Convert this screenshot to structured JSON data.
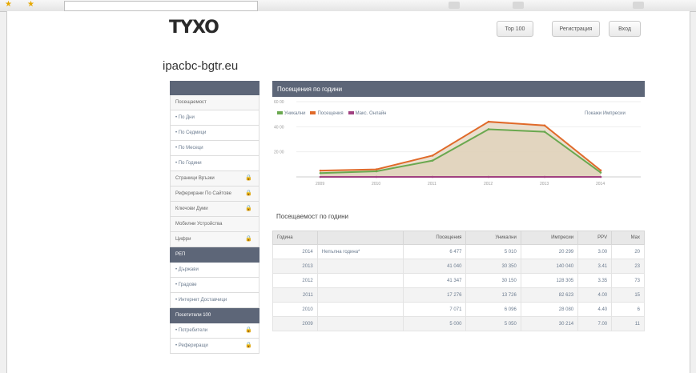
{
  "site": {
    "logo": "TYXO",
    "domain": "ipacbc-bgtr.eu"
  },
  "header": {
    "top_label": "Top 100",
    "register_label": "Регистрация",
    "login_label": "Вход"
  },
  "sidebar": {
    "items": [
      {
        "label": "Посещаемост",
        "style": "gray",
        "lock": false
      },
      {
        "label": "• По Дни",
        "style": "link",
        "lock": false
      },
      {
        "label": "• По Седмици",
        "style": "link",
        "lock": false
      },
      {
        "label": "• По Месеци",
        "style": "link",
        "lock": false
      },
      {
        "label": "• По Години",
        "style": "link",
        "lock": false
      },
      {
        "label": "Страници Връзки",
        "style": "gray",
        "lock": true
      },
      {
        "label": "Реферирани По Сайтове",
        "style": "gray",
        "lock": true
      },
      {
        "label": "Ключови Думи",
        "style": "gray",
        "lock": true
      },
      {
        "label": "Мобилни Устройства",
        "style": "gray",
        "lock": false
      },
      {
        "label": "Цифри",
        "style": "gray",
        "lock": true
      },
      {
        "label": "РЕП",
        "style": "dark",
        "lock": false
      },
      {
        "label": "• Държави",
        "style": "link",
        "lock": false
      },
      {
        "label": "• Градове",
        "style": "link",
        "lock": false
      },
      {
        "label": "• Интернет Доставчици",
        "style": "link",
        "lock": false
      },
      {
        "label": "Посетители 100",
        "style": "dark",
        "lock": false
      },
      {
        "label": "• Потребители",
        "style": "link",
        "lock": true
      },
      {
        "label": "• Рефериращи",
        "style": "link",
        "lock": true
      }
    ]
  },
  "chart": {
    "title": "Посещения по години",
    "legend": [
      {
        "label": "Уникални",
        "color": "#6aa84f"
      },
      {
        "label": "Посещения",
        "color": "#e06a2a"
      },
      {
        "label": "Макс. Онлайн",
        "color": "#a04080"
      }
    ],
    "legend_right": "Покажи Импресии"
  },
  "chart_data": {
    "type": "line",
    "categories": [
      "2009",
      "2010",
      "2011",
      "2012",
      "2013",
      "2014"
    ],
    "y_ticks": [
      "60 00",
      "40 00",
      "20 00"
    ],
    "ylim": [
      0,
      60000
    ],
    "series": [
      {
        "name": "Уникални",
        "color": "#6aa84f",
        "values": [
          3000,
          4500,
          13000,
          38000,
          36000,
          3500
        ]
      },
      {
        "name": "Посещения",
        "color": "#e06a2a",
        "values": [
          5000,
          6000,
          17000,
          44000,
          41000,
          5200
        ]
      },
      {
        "name": "Макс. Онлайн",
        "color": "#a04080",
        "values": [
          0,
          0,
          0,
          0,
          0,
          0
        ]
      }
    ]
  },
  "table": {
    "title": "Посещаемост по години",
    "headers": [
      "Година",
      "",
      "Посещения",
      "Уникални",
      "Импресии",
      "PPV",
      "Max"
    ],
    "rows": [
      [
        "2014",
        "Непълна година*",
        "6 477",
        "5 010",
        "20 299",
        "3.00",
        "20"
      ],
      [
        "2013",
        "",
        "41 040",
        "30 350",
        "140 040",
        "3.41",
        "23"
      ],
      [
        "2012",
        "",
        "41 347",
        "30 150",
        "128 305",
        "3.35",
        "73"
      ],
      [
        "2011",
        "",
        "17 276",
        "13 726",
        "82 623",
        "4.00",
        "15"
      ],
      [
        "2010",
        "",
        "7 071",
        "6 096",
        "28 080",
        "4.40",
        "6"
      ],
      [
        "2009",
        "",
        "5 000",
        "5 050",
        "30 214",
        "7.00",
        "11"
      ]
    ]
  }
}
